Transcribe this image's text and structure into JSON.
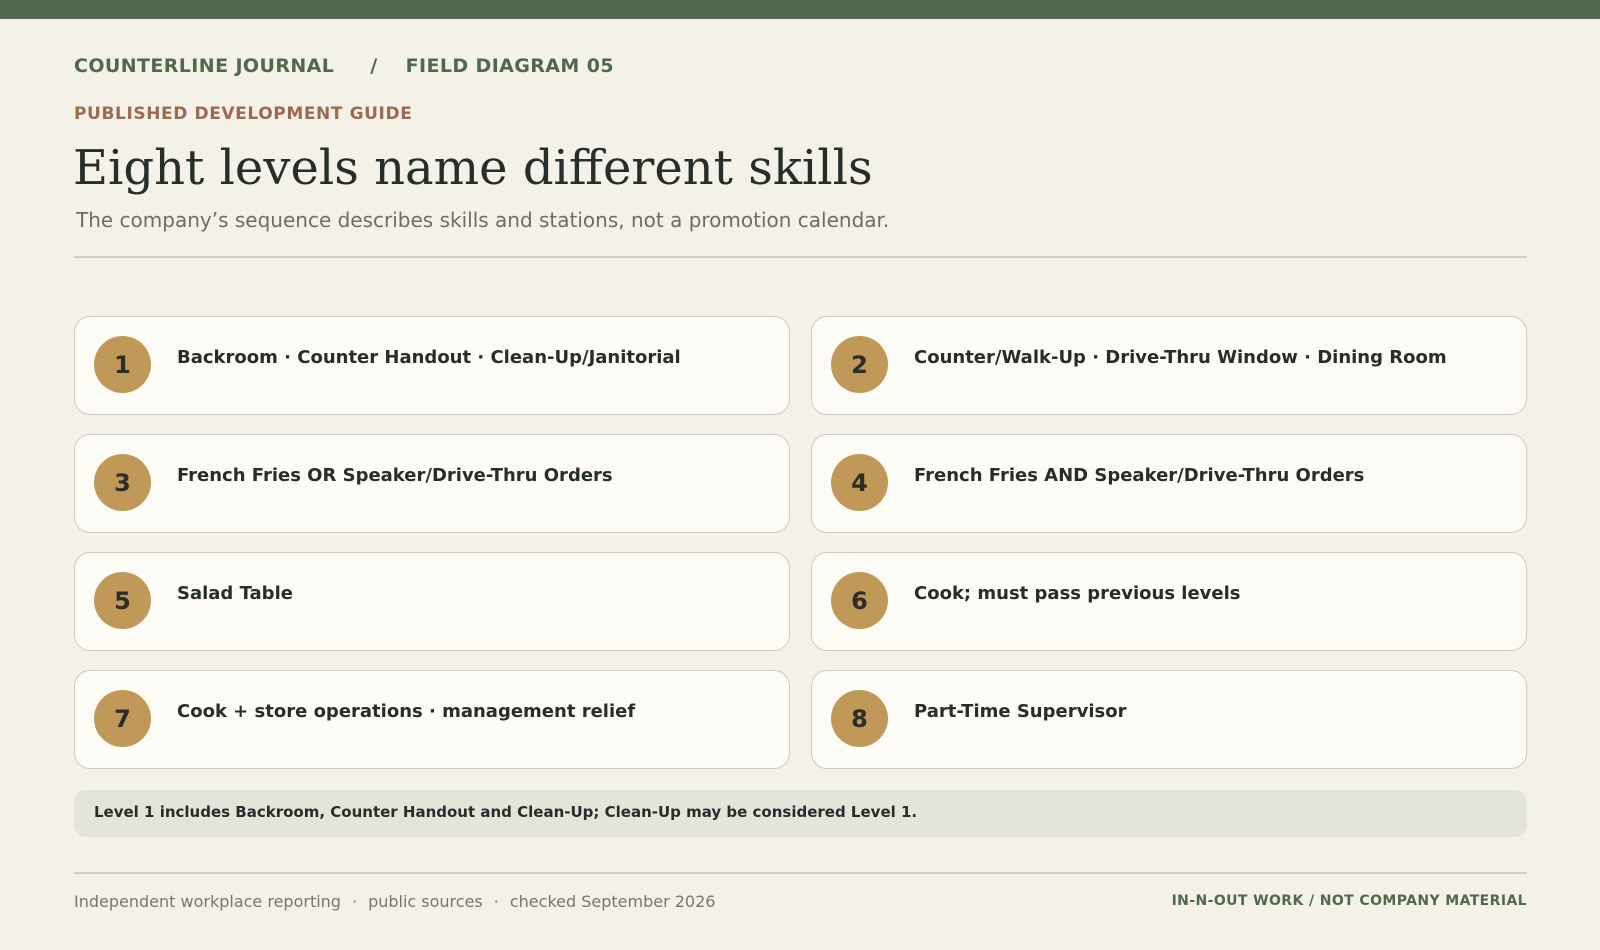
{
  "header": {
    "publication": "COUNTERLINE JOURNAL",
    "separator": "/",
    "section": "FIELD DIAGRAM 05",
    "kicker": "PUBLISHED DEVELOPMENT GUIDE",
    "title": "Eight levels name different skills",
    "subtitle": "The company’s sequence describes skills and stations, not a promotion calendar."
  },
  "levels": [
    {
      "number": "1",
      "label": "Backroom · Counter Handout · Clean-Up/Janitorial"
    },
    {
      "number": "2",
      "label": "Counter/Walk-Up · Drive-Thru Window · Dining Room"
    },
    {
      "number": "3",
      "label": "French Fries OR Speaker/Drive-Thru Orders"
    },
    {
      "number": "4",
      "label": "French Fries AND Speaker/Drive-Thru Orders"
    },
    {
      "number": "5",
      "label": "Salad Table"
    },
    {
      "number": "6",
      "label": "Cook; must pass previous levels"
    },
    {
      "number": "7",
      "label": "Cook + store operations · management relief"
    },
    {
      "number": "8",
      "label": "Part-Time Supervisor"
    }
  ],
  "note": "Level 1 includes Backroom, Counter Handout and Clean-Up; Clean-Up may be considered Level 1.",
  "footer": {
    "source_1": "Independent workplace reporting",
    "dot": "·",
    "source_2": "public sources",
    "source_3": "checked September 2026",
    "disclaimer": "IN-N-OUT WORK / NOT COMPANY MATERIAL"
  },
  "colors": {
    "accent_green": "#50684d",
    "badge_gold": "#c09857",
    "kicker_rust": "#9b6a50",
    "background": "#f4f1e8"
  }
}
